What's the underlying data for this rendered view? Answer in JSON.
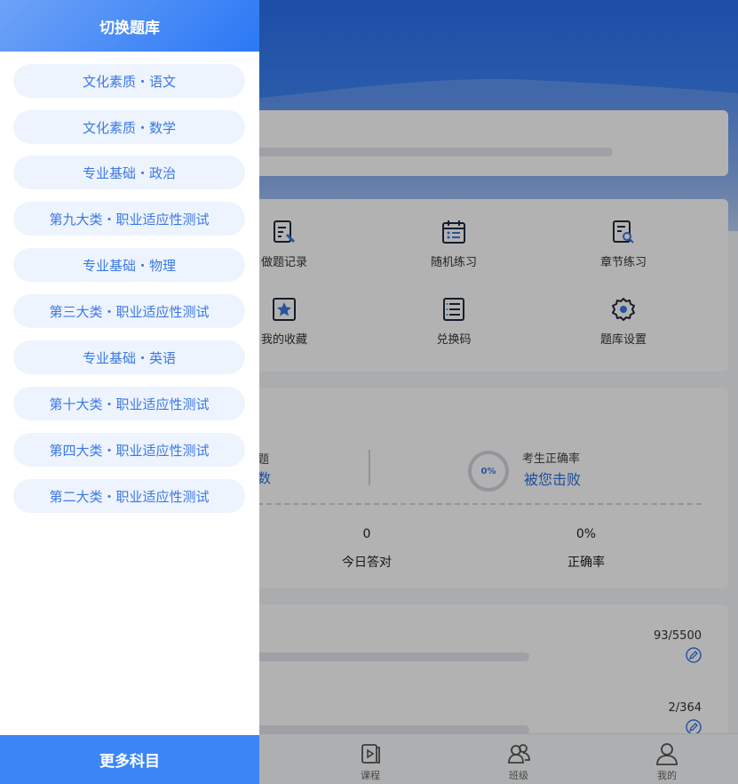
{
  "drawer": {
    "title": "切换题库",
    "subjects": [
      "文化素质・语文",
      "文化素质・数学",
      "专业基础・政治",
      "第九大类・职业适应性测试",
      "专业基础・物理",
      "第三大类・职业适应性测试",
      "专业基础・英语",
      "第十大类・职业适应性测试",
      "第四大类・职业适应性测试",
      "第二大类・职业适应性测试"
    ],
    "more_label": "更多科目"
  },
  "grid": {
    "items": [
      {
        "label": "做题记录",
        "icon": "edit-record-icon"
      },
      {
        "label": "随机练习",
        "icon": "calendar-list-icon"
      },
      {
        "label": "章节练习",
        "icon": "doc-search-icon"
      },
      {
        "label": "我的收藏",
        "icon": "star-icon"
      },
      {
        "label": "兑换码",
        "icon": "list-icon"
      },
      {
        "label": "题库设置",
        "icon": "gear-icon"
      }
    ]
  },
  "stats": {
    "partial_title": "题",
    "partial_link": "数",
    "ring_value": "0%",
    "rate_title": "考生正确率",
    "defeat_link": "被您击败",
    "today_count": "0",
    "today_label": "今日答对",
    "accuracy": "0%",
    "accuracy_label": "正确率"
  },
  "progress": [
    {
      "value": "93/5500"
    },
    {
      "value": "2/364"
    }
  ],
  "tabbar": {
    "tabs": [
      {
        "label": "课程",
        "icon": "video-icon"
      },
      {
        "label": "班级",
        "icon": "people-icon"
      },
      {
        "label": "我的",
        "icon": "user-icon"
      }
    ]
  },
  "colors": {
    "accent": "#3a78e6",
    "drawer_footer": "#3b86f7",
    "subject_bg": "#eef4fd"
  }
}
